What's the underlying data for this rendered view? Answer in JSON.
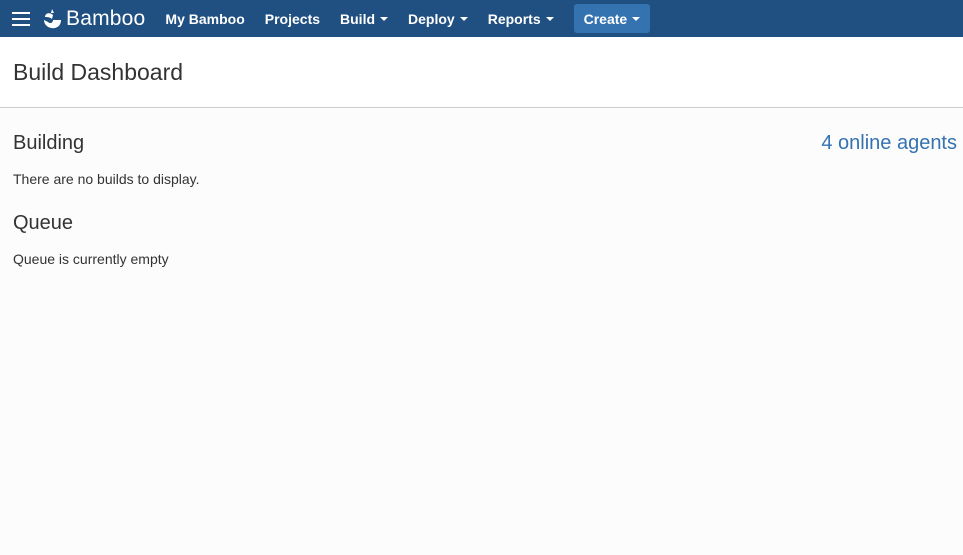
{
  "header": {
    "brand": "Bamboo",
    "nav": [
      {
        "label": "My Bamboo",
        "has_dropdown": false
      },
      {
        "label": "Projects",
        "has_dropdown": false
      },
      {
        "label": "Build",
        "has_dropdown": true
      },
      {
        "label": "Deploy",
        "has_dropdown": true
      },
      {
        "label": "Reports",
        "has_dropdown": true
      }
    ],
    "create_label": "Create",
    "colors": {
      "bar": "#205081",
      "create_button": "#3572b0"
    }
  },
  "page": {
    "title": "Build Dashboard"
  },
  "building": {
    "title": "Building",
    "message": "There are no builds to display.",
    "agents_link": "4 online agents"
  },
  "queue": {
    "title": "Queue",
    "message": "Queue is currently empty"
  },
  "colors": {
    "link": "#3572b0",
    "text": "#333333"
  }
}
